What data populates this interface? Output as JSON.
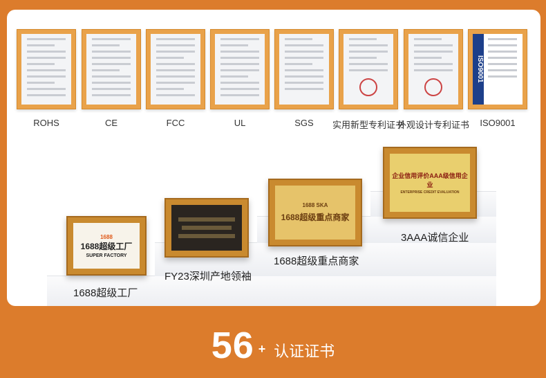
{
  "certificates": [
    {
      "label": "ROHS"
    },
    {
      "label": "CE"
    },
    {
      "label": "FCC"
    },
    {
      "label": "UL"
    },
    {
      "label": "SGS"
    },
    {
      "label": "实用新型专利证书"
    },
    {
      "label": "外观设计专利证书"
    },
    {
      "label": "ISO9001",
      "band": "ISO9001"
    }
  ],
  "awards": [
    {
      "label": "1688超级工厂",
      "plaque_title": "1688超级工厂",
      "plaque_sub": "SUPER FACTORY",
      "plaque_brand": "1688"
    },
    {
      "label": "FY23深圳产地领袖"
    },
    {
      "label": "1688超级重点商家",
      "plaque_title": "1688超级重点商家",
      "plaque_brand": "1688 SKA"
    },
    {
      "label": "3AAA诚信企业",
      "plaque_title": "企业信用评价AAA级信用企业",
      "plaque_sub": "ENTERPRISE CREDIT EVALUATION"
    }
  ],
  "footer": {
    "number": "56",
    "plus": "+",
    "text": "认证证书"
  }
}
